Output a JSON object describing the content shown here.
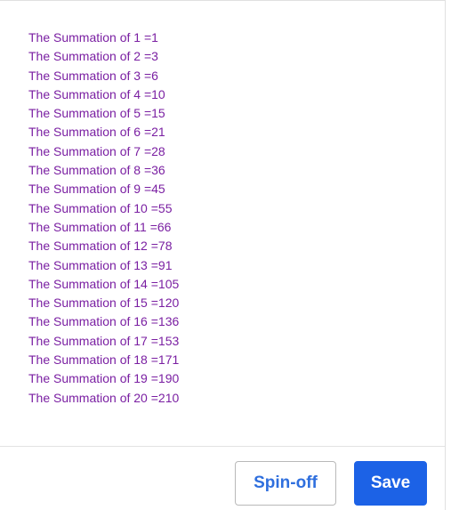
{
  "output": {
    "lines": [
      "The Summation of 1 =1",
      "The Summation of 2 =3",
      "The Summation of 3 =6",
      "The Summation of 4 =10",
      "The Summation of 5 =15",
      "The Summation of 6 =21",
      "The Summation of 7 =28",
      "The Summation of 8 =36",
      "The Summation of 9 =45",
      "The Summation of 10 =55",
      "The Summation of 11 =66",
      "The Summation of 12 =78",
      "The Summation of 13 =91",
      "The Summation of 14 =105",
      "The Summation of 15 =120",
      "The Summation of 16 =136",
      "The Summation of 17 =153",
      "The Summation of 18 =171",
      "The Summation of 19 =190",
      "The Summation of 20 =210"
    ],
    "text_color": "#7a1fa2"
  },
  "footer": {
    "spinoff_label": "Spin-off",
    "save_label": "Save",
    "primary_color": "#1c62e6"
  }
}
